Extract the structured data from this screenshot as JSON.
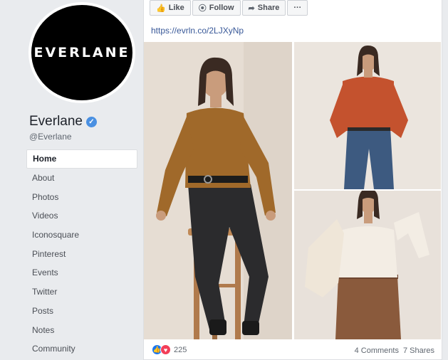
{
  "page": {
    "logo_text": "EVERLANE",
    "name": "Everlane",
    "verified_glyph": "✓",
    "handle": "@Everlane"
  },
  "nav": {
    "items": [
      "Home",
      "About",
      "Photos",
      "Videos",
      "Iconosquare",
      "Pinterest",
      "Events",
      "Twitter",
      "Posts",
      "Notes",
      "Community"
    ],
    "active_index": 0
  },
  "post": {
    "actions": [
      {
        "icon": "thumbs-up-icon",
        "glyph": "👍",
        "label": "Like"
      },
      {
        "icon": "rss-icon",
        "glyph": "⦿",
        "label": "Follow"
      },
      {
        "icon": "share-arrow-icon",
        "glyph": "➦",
        "label": "Share"
      },
      {
        "icon": "more-icon",
        "glyph": "",
        "label": "···"
      }
    ],
    "link": "https://evrln.co/2LJXyNp",
    "reaction_count": "225",
    "comments": "4 Comments",
    "shares": "7 Shares"
  },
  "colors": {
    "sweater_mustard": "#a0692a",
    "sweater_rust": "#c4522e",
    "jeans_dark": "#2b2b2d",
    "jeans_blue": "#3d5a80",
    "jacket_cream": "#efe6d8",
    "skirt_brown": "#8a5a3c"
  }
}
